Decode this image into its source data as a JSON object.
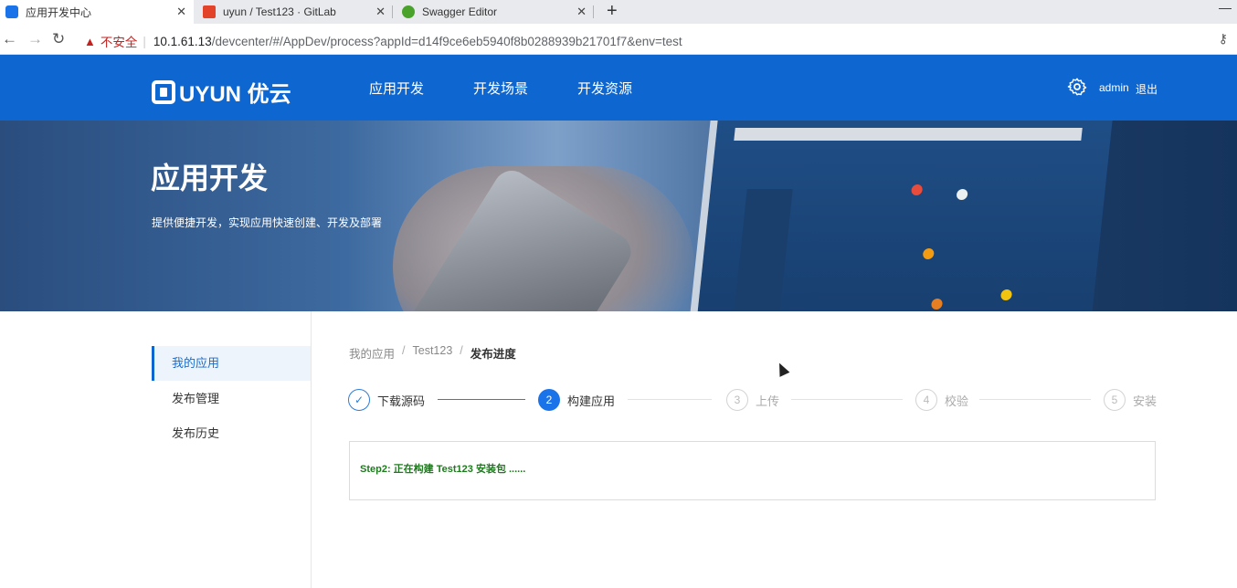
{
  "browser": {
    "tabs": [
      {
        "title": "应用开发中心",
        "icon": "uyun-favicon",
        "color": "#1a73e8",
        "active": true
      },
      {
        "title": "uyun / Test123 · GitLab",
        "icon": "gitlab-icon",
        "color": "#e24329",
        "active": false
      },
      {
        "title": "Swagger Editor",
        "icon": "swagger-icon",
        "color": "#49a32b",
        "active": false
      }
    ],
    "new_tab": "+",
    "insecure_label": "不安全",
    "url_host": "10.1.61.13",
    "url_path": "/devcenter/#/AppDev/process?appId=d14f9ce6eb5940f8b0288939b21701f7&env=test"
  },
  "header": {
    "logo_text": "UYUN 优云",
    "nav": [
      "应用开发",
      "开发场景",
      "开发资源"
    ],
    "username": "admin",
    "logout": "退出"
  },
  "banner": {
    "title": "应用开发",
    "subtitle": "提供便捷开发，实现应用快速创建、开发及部署"
  },
  "sidebar": {
    "items": [
      {
        "label": "我的应用",
        "active": true
      },
      {
        "label": "发布管理",
        "active": false
      },
      {
        "label": "发布历史",
        "active": false
      }
    ]
  },
  "breadcrumb": {
    "items": [
      "我的应用",
      "Test123"
    ],
    "current": "发布进度"
  },
  "steps": [
    {
      "number": "✓",
      "label": "下载源码",
      "state": "done"
    },
    {
      "number": "2",
      "label": "构建应用",
      "state": "current"
    },
    {
      "number": "3",
      "label": "上传",
      "state": "wait"
    },
    {
      "number": "4",
      "label": "校验",
      "state": "wait"
    },
    {
      "number": "5",
      "label": "安装",
      "state": "wait"
    }
  ],
  "log": {
    "text": "Step2: 正在构建 Test123 安装包 ......"
  },
  "colors": {
    "brand": "#0e67d0",
    "step_active": "#1a73e8",
    "log_text": "#1f7a1f"
  }
}
